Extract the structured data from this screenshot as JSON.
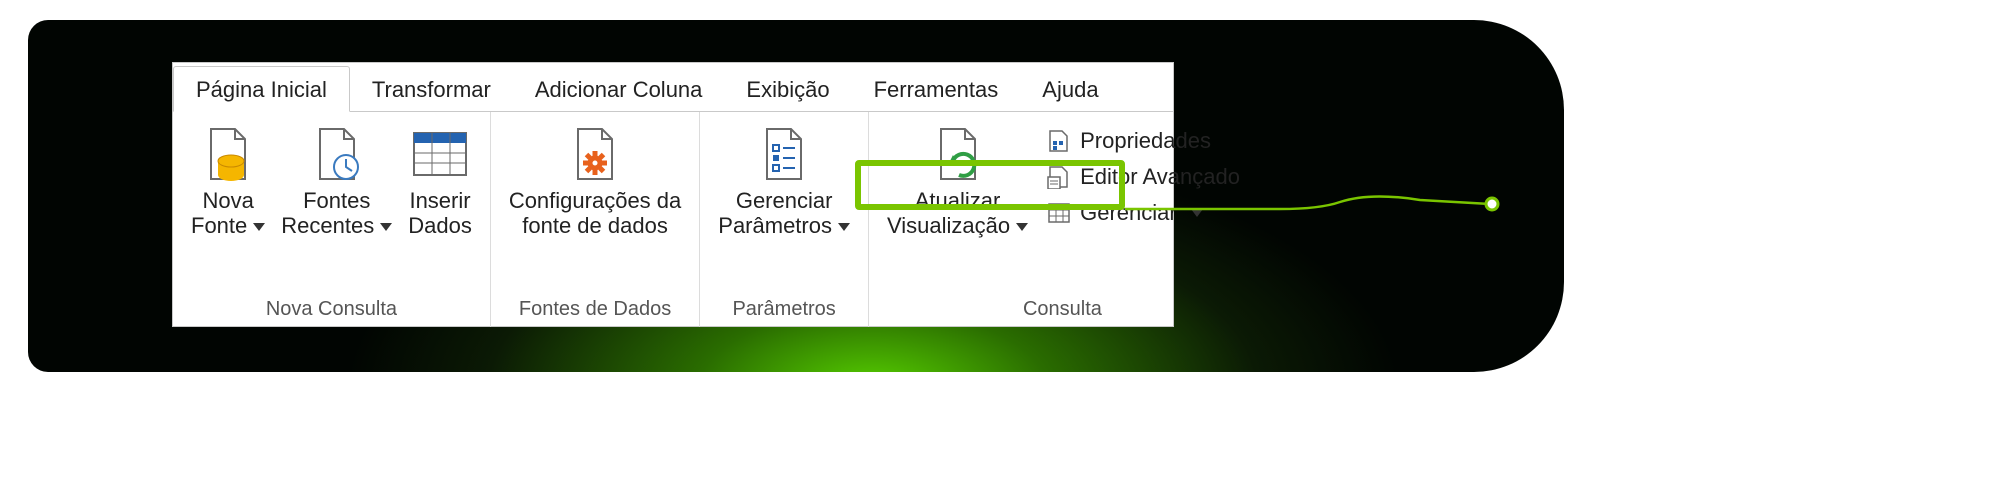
{
  "tabs": {
    "home": "Página Inicial",
    "transform": "Transformar",
    "addcol": "Adicionar Coluna",
    "view": "Exibição",
    "tools": "Ferramentas",
    "help": "Ajuda"
  },
  "group_labels": {
    "nova_consulta": "Nova Consulta",
    "fontes_de_dados": "Fontes de Dados",
    "parametros": "Parâmetros",
    "consulta": "Consulta"
  },
  "buttons": {
    "nova_fonte_l1": "Nova",
    "nova_fonte_l2": "Fonte",
    "fontes_recentes_l1": "Fontes",
    "fontes_recentes_l2": "Recentes",
    "inserir_dados_l1": "Inserir",
    "inserir_dados_l2": "Dados",
    "config_fonte_l1": "Configurações da",
    "config_fonte_l2": "fonte de dados",
    "gerenciar_param_l1": "Gerenciar",
    "gerenciar_param_l2": "Parâmetros",
    "atualizar_vis_l1": "Atualizar",
    "atualizar_vis_l2": "Visualização",
    "propriedades": "Propriedades",
    "editor_avancado": "Editor Avançado",
    "gerenciar": "Gerenciar"
  },
  "colors": {
    "highlight": "#7ac500"
  }
}
